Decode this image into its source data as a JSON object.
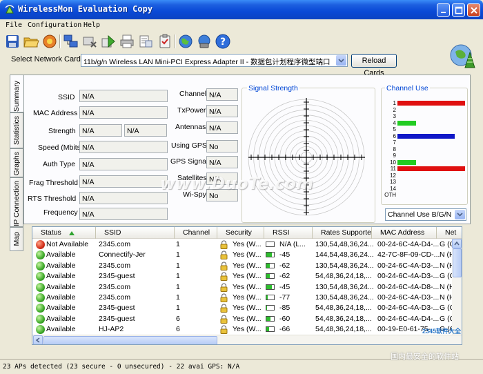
{
  "window": {
    "title": "WirelessMon Evaluation Copy"
  },
  "menu": [
    "File",
    "Configuration",
    "Help"
  ],
  "toolbar": [
    "save-icon",
    "open-folder-icon",
    "record-icon",
    "network-icon",
    "disconnect-icon",
    "export-icon",
    "print-icon",
    "clipboard-icon",
    "globe-icon",
    "connect-globe-icon",
    "help-icon"
  ],
  "network_card": {
    "label": "Select Network Card",
    "value": "11b/g/n  Wireless LAN Mini-PCI Express Adapter II - 数据包计划程序微型端口",
    "reload_label": "Reload Cards"
  },
  "tabs": [
    "Summary",
    "Statistics",
    "Graphs",
    "IP Connection",
    "Map"
  ],
  "summary": {
    "ssid_label": "SSID",
    "ssid": "N/A",
    "mac_label": "MAC Address",
    "mac": "N/A",
    "strength_label": "Strength",
    "strength_1": "N/A",
    "strength_2": "N/A",
    "speed_label": "Speed (Mbits)",
    "speed": "N/A",
    "auth_label": "Auth Type",
    "auth": "N/A",
    "frag_label": "Frag Threshold",
    "frag": "N/A",
    "rts_label": "RTS Threshold",
    "rts": "N/A",
    "freq_label": "Frequency",
    "freq": "N/A",
    "channel_label": "Channel",
    "channel": "N/A",
    "txpower_label": "TxPower",
    "txpower": "N/A",
    "antennas_label": "Antennas",
    "antennas": "N/A",
    "usinggps_label": "Using GPS",
    "usinggps": "No",
    "gpssignal_label": "GPS Signal",
    "gpssignal": "N/A",
    "satellites_label": "Satellites",
    "satellites": "N/A",
    "wispy_label": "Wi-Spy",
    "wispy": "No"
  },
  "signal_strength": {
    "title": "Signal Strength"
  },
  "channel_use": {
    "title": "Channel Use",
    "channels": [
      "1",
      "2",
      "3",
      "4",
      "5",
      "6",
      "7",
      "8",
      "9",
      "10",
      "11",
      "12",
      "13",
      "14",
      "OTH"
    ],
    "bars": [
      {
        "channel": "1",
        "color": "#E01010",
        "level": 1.0
      },
      {
        "channel": "4",
        "color": "#22CC22",
        "level": 0.28
      },
      {
        "channel": "6",
        "color": "#1018C8",
        "level": 0.85
      },
      {
        "channel": "10",
        "color": "#22CC22",
        "level": 0.28
      },
      {
        "channel": "11",
        "color": "#E01010",
        "level": 1.0
      }
    ],
    "select_value": "Channel Use B/G/N"
  },
  "table": {
    "columns": [
      "Status",
      "SSID",
      "Channel",
      "Security",
      "RSSI",
      "Rates Supported",
      "MAC Address",
      "Net"
    ],
    "rows": [
      {
        "status": "Not Available",
        "status_color": "red",
        "ssid": "2345.com",
        "channel": "1",
        "security": "Yes (W...",
        "rssi": "N/A (L...",
        "signal": 0,
        "rates": "130,54,48,36,24...",
        "mac": "00-24-6C-4A-D4-...",
        "net": "G (C"
      },
      {
        "status": "Available",
        "status_color": "green",
        "ssid": "Connectify-Jer",
        "channel": "1",
        "security": "Yes (W...",
        "rssi": "-45",
        "signal": 0.7,
        "rates": "144,54,48,36,24...",
        "mac": "42-7C-8F-09-CD-...",
        "net": "N (H"
      },
      {
        "status": "Available",
        "status_color": "green",
        "ssid": "2345.com",
        "channel": "1",
        "security": "Yes (W...",
        "rssi": "-62",
        "signal": 0.45,
        "rates": "130,54,48,36,24...",
        "mac": "00-24-6C-4A-D3-...",
        "net": "N (H"
      },
      {
        "status": "Available",
        "status_color": "green",
        "ssid": "2345-guest",
        "channel": "1",
        "security": "Yes (W...",
        "rssi": "-62",
        "signal": 0.45,
        "rates": "54,48,36,24,18,...",
        "mac": "00-24-6C-4A-D3-...",
        "net": "G (C"
      },
      {
        "status": "Available",
        "status_color": "green",
        "ssid": "2345.com",
        "channel": "1",
        "security": "Yes (W...",
        "rssi": "-45",
        "signal": 0.7,
        "rates": "130,54,48,36,24...",
        "mac": "00-24-6C-4A-D8-...",
        "net": "N (H"
      },
      {
        "status": "Available",
        "status_color": "green",
        "ssid": "2345.com",
        "channel": "1",
        "security": "Yes (W...",
        "rssi": "-77",
        "signal": 0.15,
        "rates": "130,54,48,36,24...",
        "mac": "00-24-6C-4A-D3-...",
        "net": "N (H"
      },
      {
        "status": "Available",
        "status_color": "green",
        "ssid": "2345-guest",
        "channel": "1",
        "security": "Yes (W...",
        "rssi": "-85",
        "signal": 0.08,
        "rates": "54,48,36,24,18,...",
        "mac": "00-24-6C-4A-D3-...",
        "net": "G (C"
      },
      {
        "status": "Available",
        "status_color": "green",
        "ssid": "2345-guest",
        "channel": "6",
        "security": "Yes (W...",
        "rssi": "-60",
        "signal": 0.5,
        "rates": "54,48,36,24,18,...",
        "mac": "00-24-6C-4A-D4-...",
        "net": "G (C"
      },
      {
        "status": "Available",
        "status_color": "green",
        "ssid": "HJ-AP2",
        "channel": "6",
        "security": "Yes (W...",
        "rssi": "-66",
        "signal": 0.4,
        "rates": "54,48,36,24,18,...",
        "mac": "00-19-E0-61-75-...",
        "net": "G (C"
      }
    ]
  },
  "statusbar": {
    "text": "23 APs detected (23 secure - 0 unsecured) - 22 avai GPS: N/A"
  },
  "watermarks": {
    "center": "www.DuoTe.com",
    "corner": "国内最安全的软件站",
    "corner_small": "2345软件大全"
  },
  "colors": {
    "title_blue": "#0A49D6",
    "group_title": "#0046D5"
  }
}
